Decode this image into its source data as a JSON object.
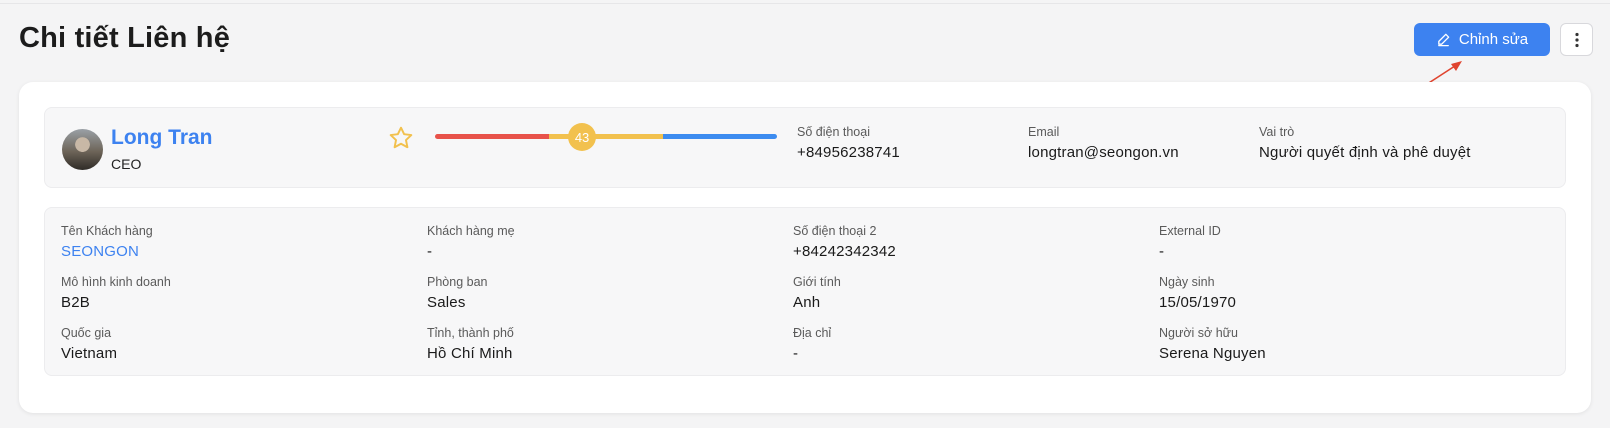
{
  "page": {
    "title": "Chi tiết Liên hệ"
  },
  "toolbar": {
    "edit_label": "Chỉnh sửa",
    "edit_icon": "pencil-icon",
    "more_icon": "more-vertical-icon",
    "accent": "#3d82f0"
  },
  "profile": {
    "name": "Long Tran",
    "role": "CEO",
    "favorite_icon": "star-outline-icon",
    "score": {
      "value": "43",
      "fraction": 0.43,
      "colors": [
        "#e8524a",
        "#f2c14e",
        "#3d8cf0"
      ]
    },
    "phone": {
      "label": "Số điện thoại",
      "value": "+84956238741"
    },
    "email": {
      "label": "Email",
      "value": "longtran@seongon.vn"
    },
    "vai_tro": {
      "label": "Vai trò",
      "value": "Người quyết định và phê duyệt"
    }
  },
  "details": {
    "rows": [
      [
        {
          "label": "Tên Khách hàng",
          "value": "SEONGON",
          "link": true
        },
        {
          "label": "Khách hàng mẹ",
          "value": "-"
        },
        {
          "label": "Số điện thoại 2",
          "value": "+84242342342"
        },
        {
          "label": "External ID",
          "value": "-"
        }
      ],
      [
        {
          "label": "Mô hình kinh doanh",
          "value": "B2B"
        },
        {
          "label": "Phòng ban",
          "value": "Sales"
        },
        {
          "label": "Giới tính",
          "value": "Anh"
        },
        {
          "label": "Ngày sinh",
          "value": "15/05/1970"
        }
      ],
      [
        {
          "label": "Quốc gia",
          "value": "Vietnam"
        },
        {
          "label": "Tỉnh, thành phố",
          "value": "Hồ Chí Minh"
        },
        {
          "label": "Địa chỉ",
          "value": "-"
        },
        {
          "label": "Người sở hữu",
          "value": "Serena Nguyen"
        }
      ]
    ]
  }
}
